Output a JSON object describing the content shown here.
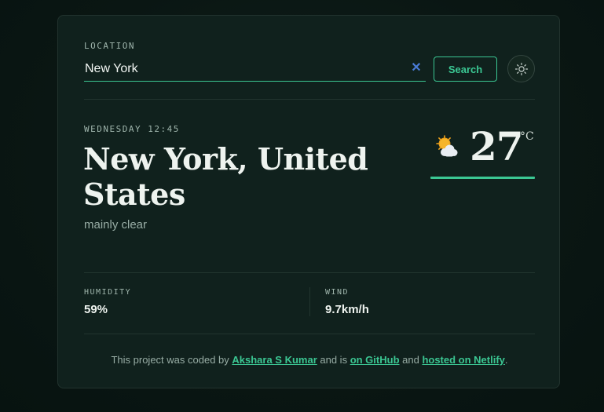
{
  "search": {
    "label": "LOCATION",
    "value": "New York",
    "clear_symbol": "✕",
    "button_label": "Search",
    "theme_icon": "sun-icon"
  },
  "current": {
    "datetime": "WEDNESDAY 12:45",
    "city": "New York, United States",
    "condition": "mainly clear",
    "icon": "partly-cloudy-icon",
    "temperature": "27",
    "unit": "°C"
  },
  "stats": {
    "humidity_label": "HUMIDITY",
    "humidity_value": "59%",
    "wind_label": "WIND",
    "wind_value": "9.7km/h"
  },
  "footer": {
    "prefix": "This project was coded by ",
    "author_link": "Akshara S Kumar",
    "middle": " and is ",
    "github_link": "on GitHub",
    "and": " and ",
    "netlify_link": "hosted on Netlify",
    "suffix": "."
  },
  "colors": {
    "accent": "#3bc793",
    "card": "#10211d",
    "background": "#0a1613"
  }
}
